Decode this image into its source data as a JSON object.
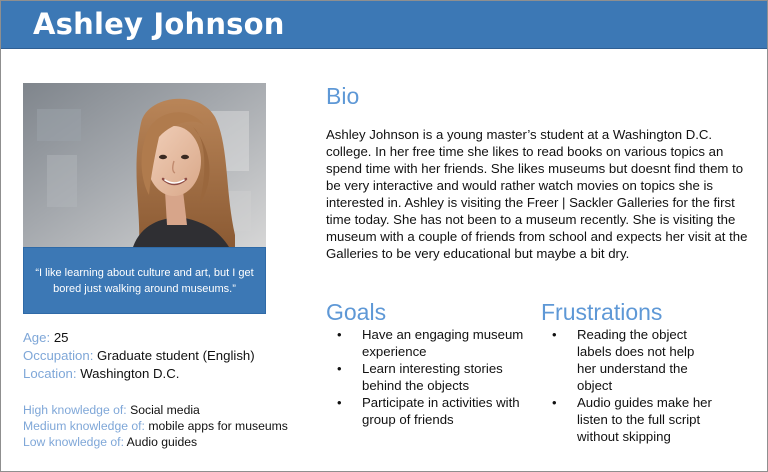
{
  "header": {
    "title": "Ashley Johnson",
    "background": "#3c78b5"
  },
  "profile": {
    "photo_icon": "profile-photo",
    "quote": "“I like learning about culture and art, but I get bored just walking around museums.”",
    "age_label": "Age:",
    "age_value": "25",
    "occupation_label": "Occupation:",
    "occupation_value": "Graduate student (English)",
    "location_label": "Location:",
    "location_value": "Washington D.C."
  },
  "knowledge": {
    "high_label": "High knowledge of:",
    "high_value": "Social media",
    "medium_label": "Medium knowledge of:",
    "medium_value": "mobile apps for museums",
    "low_label": "Low knowledge of:",
    "low_value": "Audio guides"
  },
  "bio": {
    "heading": "Bio",
    "text": "Ashley Johnson is a young master’s student at a Washington D.C. college. In her free time she likes to read books on various topics an spend time with her friends.  She likes museums but doesnt find them to be very interactive and would rather watch movies on topics she is interested in. Ashley is visiting the Freer | Sackler Galleries for the first time today. She has not been to a museum recently. She is visiting the museum with a couple of friends from school and expects her visit at the Galleries to be very educational but maybe a bit dry."
  },
  "goals": {
    "heading": "Goals",
    "items": [
      "Have an engaging museum experience",
      "Learn interesting stories behind the objects",
      "Participate in activities with group of friends"
    ]
  },
  "frustrations": {
    "heading": "Frustrations",
    "items": [
      "Reading the object labels does not help her understand the object",
      "Audio guides make her listen to the full script without skipping"
    ]
  },
  "colors": {
    "accent": "#3c78b5",
    "heading": "#5e98d6",
    "label": "#7fa7d8"
  }
}
